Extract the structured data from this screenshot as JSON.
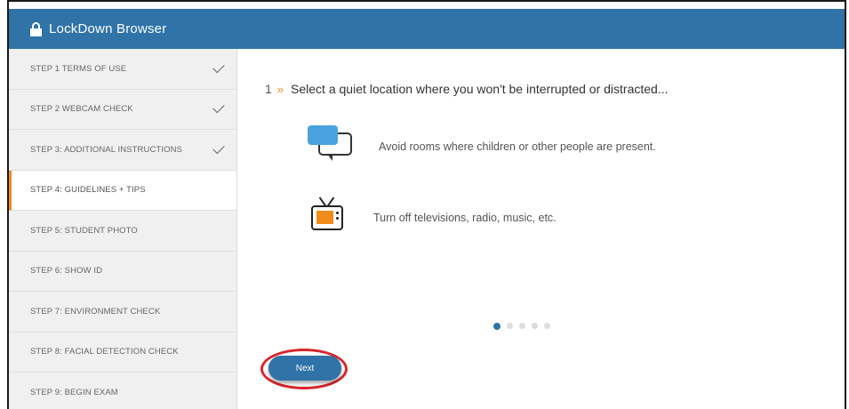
{
  "app": {
    "title": "LockDown Browser"
  },
  "sidebar": {
    "steps": [
      {
        "label": "STEP 1 TERMS OF USE",
        "completed": true
      },
      {
        "label": "STEP 2 WEBCAM CHECK",
        "completed": true
      },
      {
        "label": "STEP 3: ADDITIONAL INSTRUCTIONS",
        "completed": true
      },
      {
        "label": "STEP 4: GUIDELINES + TIPS",
        "active": true
      },
      {
        "label": "STEP 5: STUDENT PHOTO"
      },
      {
        "label": "STEP 6: SHOW ID"
      },
      {
        "label": "STEP 7: ENVIRONMENT CHECK"
      },
      {
        "label": "STEP 8: FACIAL DETECTION CHECK"
      },
      {
        "label": "STEP 9: BEGIN EXAM"
      }
    ]
  },
  "main": {
    "number": "1",
    "chevron": "»",
    "heading": "Select a quiet location where you won't be interrupted or distracted...",
    "tips": [
      {
        "icon": "chat-bubbles-icon",
        "text": "Avoid rooms where children or other people are present."
      },
      {
        "icon": "television-icon",
        "text": "Turn off televisions, radio, music, etc."
      }
    ],
    "pagination": {
      "total": 5,
      "current": 1
    },
    "next_label": "Next"
  },
  "colors": {
    "titlebar": "#2f73a8",
    "accent": "#f08c1c",
    "highlight_ring": "#d8262b"
  }
}
